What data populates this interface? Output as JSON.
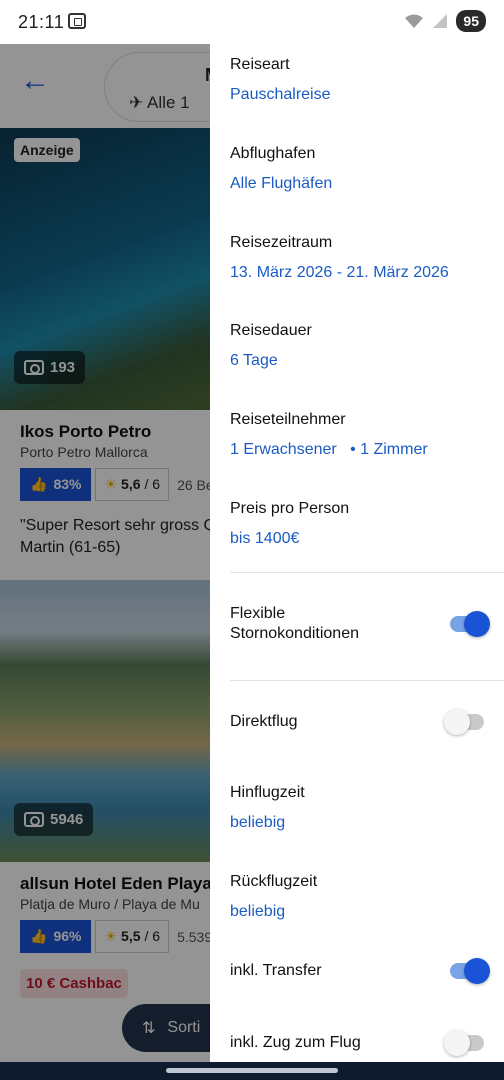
{
  "status_bar": {
    "time": "21:11",
    "battery": "95"
  },
  "background": {
    "title_partial": "M",
    "filter_label": "Alle",
    "filter_extra": "1",
    "hotels": [
      {
        "ad_label": "Anzeige",
        "photos": "193",
        "name": "Ikos Porto Petro",
        "location": "Porto Petro Mallorca",
        "recommend": "83%",
        "sun_score": "5,6",
        "sun_max": "/ 6",
        "reviews": "26 Be",
        "quote": "\"Super Resort sehr gross Qualität\"",
        "reviewer": "Martin (61-65)"
      },
      {
        "photos": "5946",
        "name": "allsun Hotel Eden Playa",
        "location": "Platja de Muro / Playa de Mu",
        "recommend": "96%",
        "sun_score": "5,5",
        "sun_max": "/ 6",
        "reviews": "5.539",
        "cashback": "10 € Cashbac"
      }
    ],
    "sort_label": "Sorti"
  },
  "drawer": {
    "travel_type": {
      "label": "Reiseart",
      "value": "Pauschalreise"
    },
    "departure": {
      "label": "Abflughafen",
      "value": "Alle Flughäfen"
    },
    "period": {
      "label": "Reisezeitraum",
      "value": "13. März 2026 - 21. März 2026"
    },
    "duration": {
      "label": "Reisedauer",
      "value": "6 Tage"
    },
    "travelers": {
      "label": "Reiseteilnehmer",
      "adults": "1 Erwachsener",
      "separator": "•",
      "rooms": "1 Zimmer"
    },
    "price": {
      "label": "Preis pro Person",
      "value": "bis 1400€"
    },
    "flexible": {
      "label": "Flexible Stornokonditionen",
      "on": true
    },
    "direct": {
      "label": "Direktflug",
      "on": false
    },
    "outbound": {
      "label": "Hinflugzeit",
      "value": "beliebig"
    },
    "return": {
      "label": "Rückflugzeit",
      "value": "beliebig"
    },
    "transfer": {
      "label": "inkl. Transfer",
      "on": true
    },
    "train": {
      "label": "inkl. Zug zum Flug",
      "on": false
    }
  },
  "colors": {
    "accent": "#1a53d6",
    "link": "#1a5bc4",
    "cashback": "#c2182d"
  }
}
